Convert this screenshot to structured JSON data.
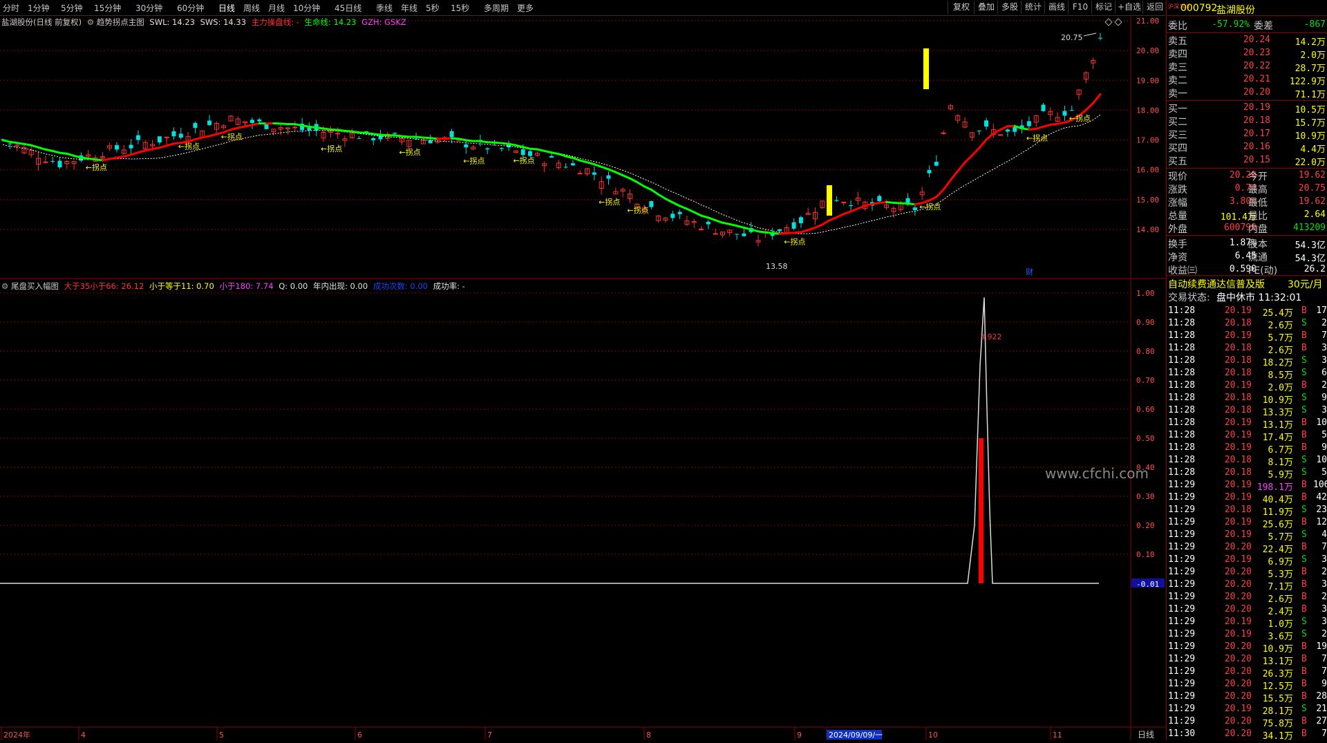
{
  "toolbar": {
    "periods": [
      "分时",
      "1分钟",
      "5分钟",
      "15分钟",
      "30分钟",
      "60分钟",
      "日线",
      "周线",
      "月线",
      "10分钟",
      "45日线",
      "季线",
      "年线",
      "5秒",
      "15秒",
      "多周期",
      "更多"
    ],
    "active_period": "日线",
    "right_buttons": [
      "复权",
      "叠加",
      "多股",
      "统计",
      "画线",
      "F10",
      "标记",
      "+自选",
      "返回"
    ]
  },
  "main_legend": {
    "stock": "盐湖股份(日线 前复权)",
    "indicator": "趋势拐点主图",
    "swl": "SWL: 14.23",
    "sws": "SWS: 14.33",
    "main_line": "主力操盘线: -",
    "life_line": "生命线: 14.23",
    "gzh": "GZH: GSKZ"
  },
  "sub_legend": {
    "name": "尾盘买入幅图",
    "p1": "大于35小于66: 26.12",
    "p2": "小于等于11: 0.70",
    "p3": "小于180: 7.74",
    "p4": "Q: 0.00",
    "p5": "年内出现: 0.00",
    "p6": "成功次数: 0.00",
    "p7": "成功率: -"
  },
  "annotations": {
    "peak_label": "20.75",
    "low_label": "13.58",
    "sub_peak_label": "3.922",
    "turn_label": "←拐点",
    "cai_icon": "财",
    "watermark": "www.cfchi.com"
  },
  "price_axis": [
    "21.00",
    "20.00",
    "19.00",
    "18.00",
    "17.00",
    "16.00",
    "15.00",
    "14.00"
  ],
  "sub_axis": [
    "1.00",
    "0.90",
    "0.80",
    "0.70",
    "0.60",
    "0.50",
    "0.40",
    "0.30",
    "0.20",
    "0.10",
    "-0.01"
  ],
  "date_axis": [
    {
      "label": "2024年"
    },
    {
      "label": "4"
    },
    {
      "label": "5"
    },
    {
      "label": "6"
    },
    {
      "label": "7"
    },
    {
      "label": "8"
    },
    {
      "label": "9"
    },
    {
      "label": "2024/09/09/一"
    },
    {
      "label": "10"
    },
    {
      "label": "11"
    }
  ],
  "bottom_right_label": "日线",
  "quote": {
    "code": "000792",
    "name": "盐湖股份",
    "index_tag": "沪深300",
    "weibi_label": "委比",
    "weibi": "-57.92%",
    "weicha_label": "委差",
    "weicha": "-867",
    "asks": [
      {
        "label": "卖五",
        "price": "20.24",
        "vol": "14.2万"
      },
      {
        "label": "卖四",
        "price": "20.23",
        "vol": "2.0万"
      },
      {
        "label": "卖三",
        "price": "20.22",
        "vol": "28.7万"
      },
      {
        "label": "卖二",
        "price": "20.21",
        "vol": "122.9万"
      },
      {
        "label": "卖一",
        "price": "20.20",
        "vol": "71.1万"
      }
    ],
    "bids": [
      {
        "label": "买一",
        "price": "20.19",
        "vol": "10.5万"
      },
      {
        "label": "买二",
        "price": "20.18",
        "vol": "15.7万"
      },
      {
        "label": "买三",
        "price": "20.17",
        "vol": "10.9万"
      },
      {
        "label": "买四",
        "price": "20.16",
        "vol": "4.4万"
      },
      {
        "label": "买五",
        "price": "20.15",
        "vol": "22.0万"
      }
    ],
    "stats": [
      {
        "l1": "现价",
        "v1": "20.20",
        "c1": "red",
        "l2": "今开",
        "v2": "19.62",
        "c2": "red"
      },
      {
        "l1": "涨跌",
        "v1": "0.74",
        "c1": "red",
        "l2": "最高",
        "v2": "20.75",
        "c2": "red"
      },
      {
        "l1": "涨幅",
        "v1": "3.80%",
        "c1": "red",
        "l2": "最低",
        "v2": "19.62",
        "c2": "red"
      },
      {
        "l1": "总量",
        "v1": "101.4万",
        "c1": "yellow",
        "l2": "量比",
        "v2": "2.64",
        "c2": "yellow"
      },
      {
        "l1": "外盘",
        "v1": "600799",
        "c1": "red",
        "l2": "内盘",
        "v2": "413209",
        "c2": "green"
      },
      {
        "l1": "换手",
        "v1": "1.87%",
        "c1": "white",
        "l2": "股本",
        "v2": "54.3亿",
        "c2": "white"
      },
      {
        "l1": "净资",
        "v1": "6.45",
        "c1": "white",
        "l2": "流通",
        "v2": "54.3亿",
        "c2": "white"
      },
      {
        "l1": "收益㈢",
        "v1": "0.590",
        "c1": "white",
        "l2": "PE(动)",
        "v2": "26.2",
        "c2": "white"
      }
    ],
    "ad_text": "自动续费通达信普及版",
    "ad_price": "30元/月",
    "status_label": "交易状态:",
    "status_value": "盘中休市 11:32:01"
  },
  "ticks": [
    {
      "t": "11:28",
      "p": "20.19",
      "v": "25.4万",
      "d": "B",
      "n": "17"
    },
    {
      "t": "11:28",
      "p": "20.18",
      "v": "2.6万",
      "d": "S",
      "n": "2"
    },
    {
      "t": "11:28",
      "p": "20.19",
      "v": "5.7万",
      "d": "B",
      "n": "7"
    },
    {
      "t": "11:28",
      "p": "20.18",
      "v": "2.6万",
      "d": "B",
      "n": "3"
    },
    {
      "t": "11:28",
      "p": "20.18",
      "v": "18.2万",
      "d": "S",
      "n": "3"
    },
    {
      "t": "11:28",
      "p": "20.18",
      "v": "8.5万",
      "d": "S",
      "n": "6"
    },
    {
      "t": "11:28",
      "p": "20.19",
      "v": "2.0万",
      "d": "B",
      "n": "2"
    },
    {
      "t": "11:28",
      "p": "20.18",
      "v": "10.9万",
      "d": "S",
      "n": "9"
    },
    {
      "t": "11:28",
      "p": "20.18",
      "v": "13.3万",
      "d": "S",
      "n": "3"
    },
    {
      "t": "11:28",
      "p": "20.19",
      "v": "13.1万",
      "d": "B",
      "n": "10"
    },
    {
      "t": "11:28",
      "p": "20.19",
      "v": "17.4万",
      "d": "B",
      "n": "5"
    },
    {
      "t": "11:28",
      "p": "20.19",
      "v": "6.7万",
      "d": "B",
      "n": "9"
    },
    {
      "t": "11:28",
      "p": "20.18",
      "v": "8.1万",
      "d": "S",
      "n": "10"
    },
    {
      "t": "11:28",
      "p": "20.18",
      "v": "5.9万",
      "d": "S",
      "n": "5"
    },
    {
      "t": "11:29",
      "p": "20.19",
      "v": "198.1万",
      "d": "B",
      "n": "106"
    },
    {
      "t": "11:29",
      "p": "20.19",
      "v": "40.4万",
      "d": "B",
      "n": "42"
    },
    {
      "t": "11:29",
      "p": "20.18",
      "v": "11.9万",
      "d": "S",
      "n": "23"
    },
    {
      "t": "11:29",
      "p": "20.19",
      "v": "25.6万",
      "d": "B",
      "n": "12"
    },
    {
      "t": "11:29",
      "p": "20.19",
      "v": "5.7万",
      "d": "S",
      "n": "4"
    },
    {
      "t": "11:29",
      "p": "20.20",
      "v": "22.4万",
      "d": "B",
      "n": "7"
    },
    {
      "t": "11:29",
      "p": "20.19",
      "v": "6.9万",
      "d": "S",
      "n": "3"
    },
    {
      "t": "11:29",
      "p": "20.20",
      "v": "5.3万",
      "d": "B",
      "n": "2"
    },
    {
      "t": "11:29",
      "p": "20.20",
      "v": "7.1万",
      "d": "B",
      "n": "3"
    },
    {
      "t": "11:29",
      "p": "20.20",
      "v": "2.6万",
      "d": "B",
      "n": "2"
    },
    {
      "t": "11:29",
      "p": "20.20",
      "v": "2.4万",
      "d": "B",
      "n": "3"
    },
    {
      "t": "11:29",
      "p": "20.19",
      "v": "1.0万",
      "d": "S",
      "n": "3"
    },
    {
      "t": "11:29",
      "p": "20.19",
      "v": "3.6万",
      "d": "S",
      "n": "2"
    },
    {
      "t": "11:29",
      "p": "20.20",
      "v": "10.9万",
      "d": "B",
      "n": "19"
    },
    {
      "t": "11:29",
      "p": "20.20",
      "v": "13.1万",
      "d": "B",
      "n": "7"
    },
    {
      "t": "11:29",
      "p": "20.20",
      "v": "26.3万",
      "d": "B",
      "n": "7"
    },
    {
      "t": "11:29",
      "p": "20.20",
      "v": "12.5万",
      "d": "B",
      "n": "9"
    },
    {
      "t": "11:29",
      "p": "20.20",
      "v": "15.5万",
      "d": "B",
      "n": "28"
    },
    {
      "t": "11:29",
      "p": "20.19",
      "v": "28.1万",
      "d": "S",
      "n": "21"
    },
    {
      "t": "11:29",
      "p": "20.20",
      "v": "75.8万",
      "d": "B",
      "n": "27"
    },
    {
      "t": "11:30",
      "p": "20.20",
      "v": "34.1万",
      "d": "B",
      "n": "7"
    }
  ],
  "colors": {
    "up": "#ff3030",
    "down": "#00e0e0",
    "ma_red": "#ff0000",
    "ma_green": "#00ff00",
    "grid": "#8b0000",
    "signal": "#ffff00"
  }
}
